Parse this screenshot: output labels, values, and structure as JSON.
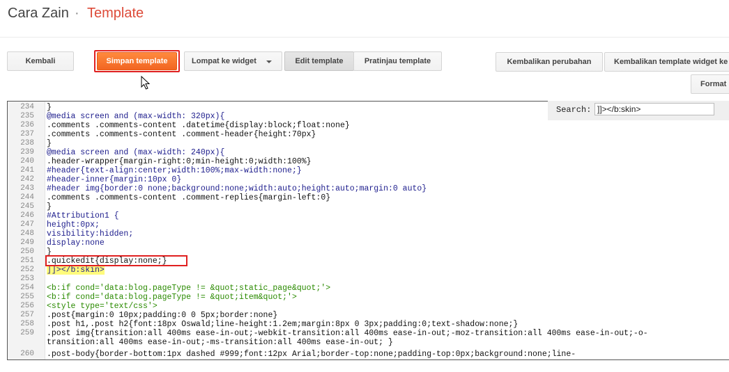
{
  "header": {
    "blog_name": "Cara Zain",
    "separator": "·",
    "page_name": "Template"
  },
  "toolbar": {
    "back_label": "Kembali",
    "save_label": "Simpan template",
    "jump_label": "Lompat ke widget",
    "edit_label": "Edit template",
    "preview_label": "Pratinjau template",
    "revert_label": "Kembalikan perubahan",
    "revert_widget_label": "Kembalikan template widget ke",
    "format_label": "Format"
  },
  "search": {
    "label": "Search:",
    "value": "]]></b:skin>"
  },
  "code_lines": [
    {
      "n": "234",
      "text": "}",
      "style": ""
    },
    {
      "n": "235",
      "text": "@media screen and (max-width: 320px){",
      "style": "blue"
    },
    {
      "n": "236",
      "text": ".comments .comments-content .datetime{display:block;float:none}",
      "style": ""
    },
    {
      "n": "237",
      "text": ".comments .comments-content .comment-header{height:70px}",
      "style": ""
    },
    {
      "n": "238",
      "text": "}",
      "style": ""
    },
    {
      "n": "239",
      "text": "@media screen and (max-width: 240px){",
      "style": "blue"
    },
    {
      "n": "240",
      "text": ".header-wrapper{margin-right:0;min-height:0;width:100%}",
      "style": ""
    },
    {
      "n": "241",
      "text": "#header{text-align:center;width:100%;max-width:none;}",
      "style": "blue"
    },
    {
      "n": "242",
      "text": "#header-inner{margin:10px 0}",
      "style": "blue"
    },
    {
      "n": "243",
      "text": "#header img{border:0 none;background:none;width:auto;height:auto;margin:0 auto}",
      "style": "blue"
    },
    {
      "n": "244",
      "text": ".comments .comments-content .comment-replies{margin-left:0}",
      "style": ""
    },
    {
      "n": "245",
      "text": "}",
      "style": ""
    },
    {
      "n": "246",
      "text": "#Attribution1 {",
      "style": "blue"
    },
    {
      "n": "247",
      "text": "height:0px;",
      "style": "blue"
    },
    {
      "n": "248",
      "text": "visibility:hidden;",
      "style": "blue"
    },
    {
      "n": "249",
      "text": "display:none",
      "style": "blue"
    },
    {
      "n": "250",
      "text": "}",
      "style": ""
    },
    {
      "n": "251",
      "text": ".quickedit{display:none;}",
      "style": ""
    },
    {
      "n": "252",
      "text": "]]></b:skin>",
      "style": "yellow"
    },
    {
      "n": "253",
      "text": "",
      "style": ""
    },
    {
      "n": "254",
      "text": "<b:if cond='data:blog.pageType != &quot;static_page&quot;'>",
      "style": "green"
    },
    {
      "n": "255",
      "text": "<b:if cond='data:blog.pageType != &quot;item&quot;'>",
      "style": "green"
    },
    {
      "n": "256",
      "text": "<style type='text/css'>",
      "style": "green"
    },
    {
      "n": "257",
      "text": ".post{margin:0 10px;padding:0 0 5px;border:none}",
      "style": ""
    },
    {
      "n": "258",
      "text": ".post h1,.post h2{font:18px Oswald;line-height:1.2em;margin:8px 0 3px;padding:0;text-shadow:none;}",
      "style": ""
    },
    {
      "n": "259",
      "text": ".post img{transition:all 400ms ease-in-out;-webkit-transition:all 400ms ease-in-out;-moz-transition:all 400ms ease-in-out;-o-",
      "style": ""
    },
    {
      "n": "",
      "text": "transition:all 400ms ease-in-out;-ms-transition:all 400ms ease-in-out; }",
      "style": ""
    },
    {
      "n": "260",
      "text": ".post-body{border-bottom:1px dashed #999;font:12px Arial;border-top:none;padding-top:0px;background:none;line-",
      "style": ""
    }
  ]
}
